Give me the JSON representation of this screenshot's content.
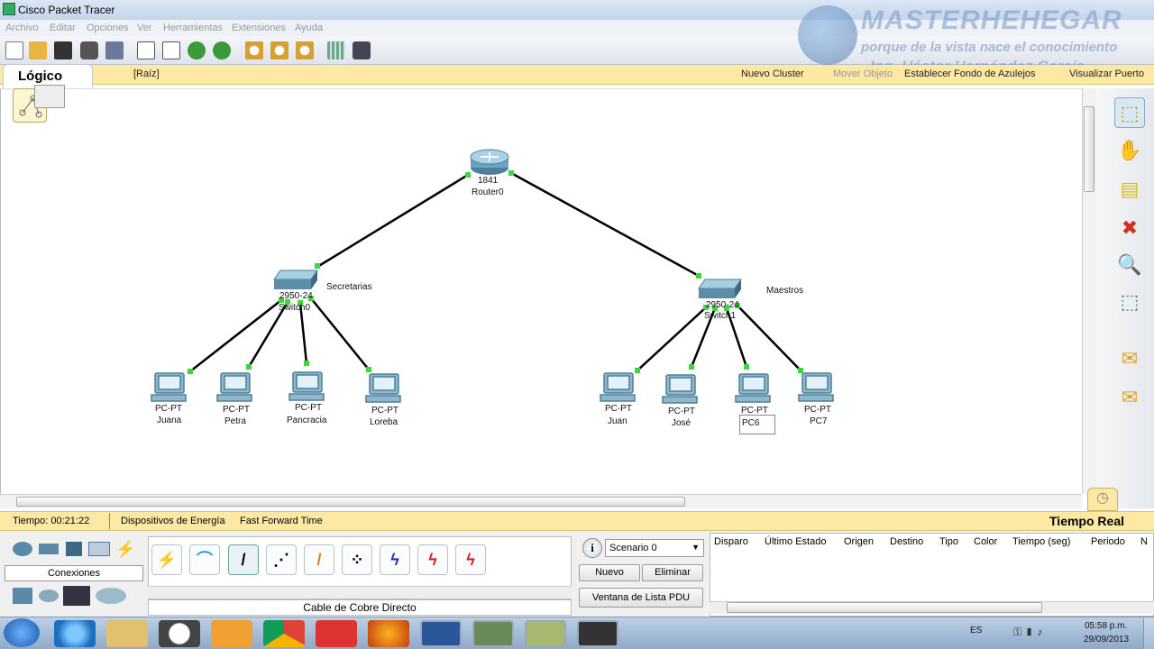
{
  "window": {
    "title": "Cisco Packet Tracer"
  },
  "menu": [
    "Archivo",
    "Editar",
    "Opciones",
    "Ver",
    "Herramientas",
    "Extensiones",
    "Ayuda"
  ],
  "watermark": {
    "line1": "MASTERHEHEGAR",
    "line2": "porque de la vista nace el conocimiento",
    "line3": "Ing. Héctor Hernández García"
  },
  "workspace": {
    "tab_label": "Lógico",
    "root_label": "[Raíz]",
    "new_cluster": "Nuevo Cluster",
    "move_object": "Mover Objeto",
    "set_background": "Establecer Fondo de Azulejos",
    "view_port": "Visualizar Puerto"
  },
  "network": {
    "router": {
      "model": "1841",
      "name": "Router0"
    },
    "switch0": {
      "model": "2950-24",
      "name": "Switch0",
      "label": "Secretarias"
    },
    "switch1": {
      "model": "2950-24",
      "name": "Switch1",
      "label": "Maestros"
    },
    "pcs": [
      {
        "type": "PC-PT",
        "name": "Juana"
      },
      {
        "type": "PC-PT",
        "name": "Petra"
      },
      {
        "type": "PC-PT",
        "name": "Pancracia"
      },
      {
        "type": "PC-PT",
        "name": "Loreba"
      },
      {
        "type": "PC-PT",
        "name": "Juan"
      },
      {
        "type": "PC-PT",
        "name": "José"
      },
      {
        "type": "PC-PT",
        "name": "PC6"
      },
      {
        "type": "PC-PT",
        "name": "PC7"
      }
    ]
  },
  "status": {
    "time": "Tiempo: 00:21:22",
    "power": "Dispositivos de Energía",
    "fast_forward": "Fast Forward Time",
    "mode": "Tiempo Real"
  },
  "devices": {
    "category_label": "Conexiones",
    "cable_label": "Cable de Cobre Directo"
  },
  "scenario": {
    "selected": "Scenario 0",
    "new_button": "Nuevo",
    "delete_button": "Eliminar",
    "pdu_button": "Ventana de Lista PDU"
  },
  "pdu_table": {
    "columns": [
      "Disparo",
      "Último Estado",
      "Origen",
      "Destino",
      "Tipo",
      "Color",
      "Tiempo (seg)",
      "Periodo",
      "N"
    ]
  },
  "taskbar": {
    "lang": "ES",
    "time": "05:58 p.m.",
    "date": "29/09/2013"
  }
}
